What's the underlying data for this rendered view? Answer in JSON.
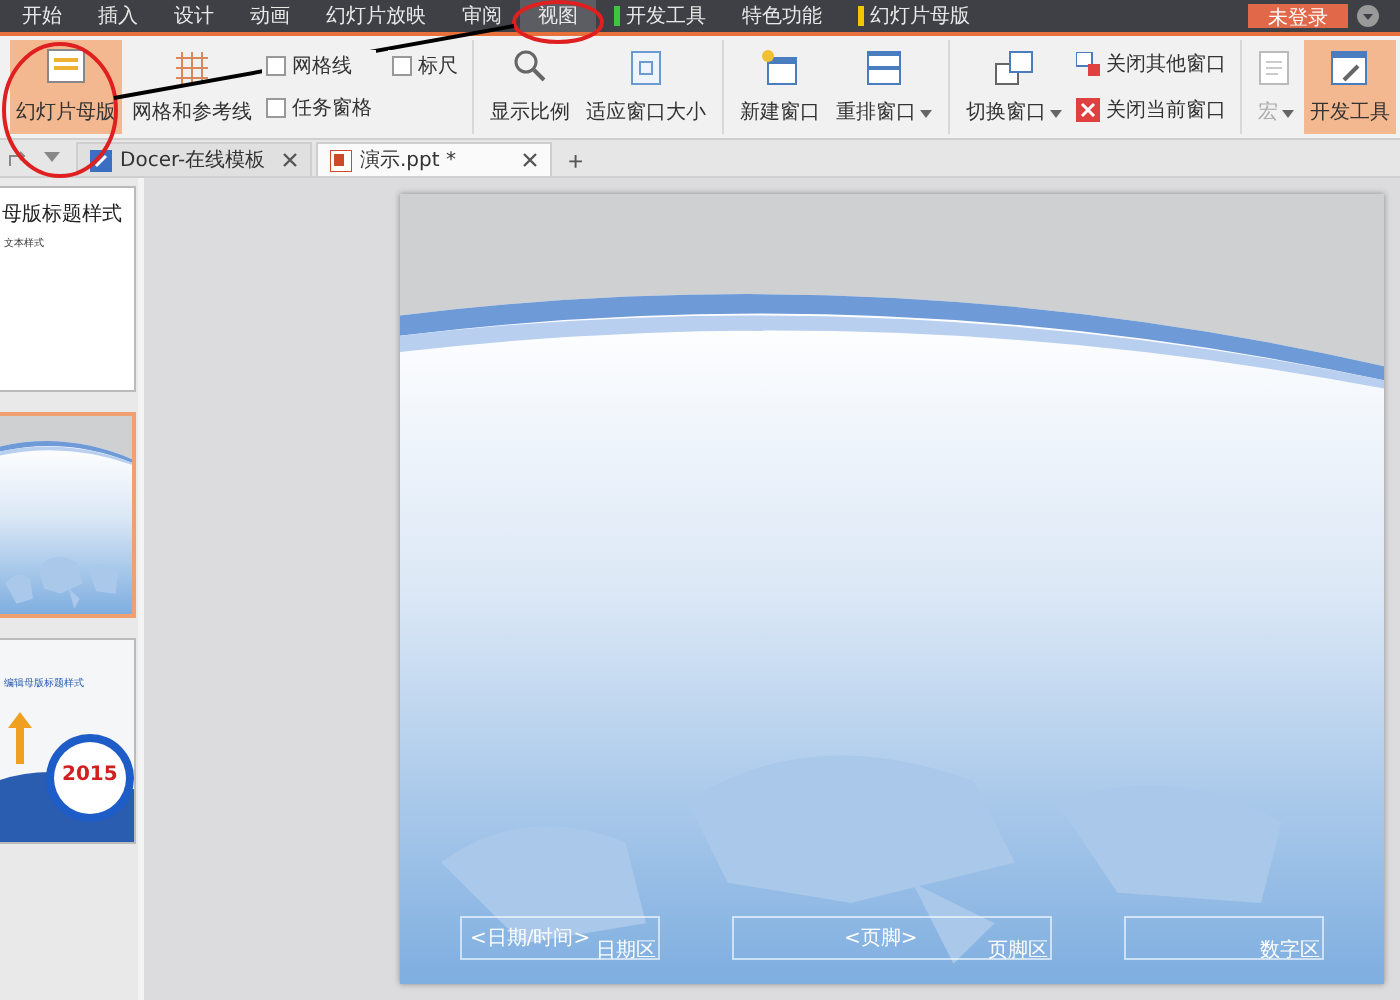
{
  "menu_tabs": [
    {
      "label": "开始",
      "selected": false
    },
    {
      "label": "插入",
      "selected": false
    },
    {
      "label": "设计",
      "selected": false
    },
    {
      "label": "动画",
      "selected": false
    },
    {
      "label": "幻灯片放映",
      "selected": false
    },
    {
      "label": "审阅",
      "selected": false
    },
    {
      "label": "视图",
      "selected": true
    },
    {
      "label": "开发工具",
      "selected": false,
      "color": "#3cc83c"
    },
    {
      "label": "特色功能",
      "selected": false
    },
    {
      "label": "幻灯片母版",
      "selected": false,
      "color": "#f0c800"
    }
  ],
  "login_button": "未登录",
  "ribbon": [
    {
      "items": [
        {
          "kind": "large",
          "label": "幻灯片母版",
          "selected": true
        },
        {
          "kind": "large",
          "label": "网格和参考线",
          "selected": false
        },
        {
          "kind": "checks",
          "checks": [
            {
              "label": "网格线",
              "checked": false
            },
            {
              "label": "标尺",
              "checked": false
            },
            {
              "label": "任务窗格",
              "checked": false
            }
          ]
        }
      ]
    },
    {
      "items": [
        {
          "kind": "large",
          "label": "显示比例",
          "selected": false
        },
        {
          "kind": "large",
          "label": "适应窗口大小",
          "selected": false
        }
      ]
    },
    {
      "items": [
        {
          "kind": "large",
          "label": "新建窗口",
          "selected": false
        },
        {
          "kind": "large",
          "label": "重排窗口",
          "selected": false,
          "dropdown": true
        }
      ]
    },
    {
      "items": [
        {
          "kind": "large",
          "label": "切换窗口",
          "selected": false,
          "dropdown": true
        },
        {
          "kind": "smalls",
          "smalls": [
            {
              "label": "关闭其他窗口"
            },
            {
              "label": "关闭当前窗口"
            }
          ]
        }
      ]
    },
    {
      "items": [
        {
          "kind": "large",
          "label": "宏",
          "selected": false,
          "dropdown": true,
          "disabled": true
        },
        {
          "kind": "large",
          "label": "开发工具",
          "selected": true
        }
      ]
    }
  ],
  "doc_tabs": [
    {
      "label": "Docer-在线模板",
      "selected": false
    },
    {
      "label": "演示.ppt *",
      "selected": true
    }
  ],
  "new_tab_button": "+",
  "thumbnails": [
    {
      "kind": "title",
      "selected": false,
      "title": "母版标题样式",
      "body": "文本样式"
    },
    {
      "kind": "picture",
      "selected": true
    },
    {
      "kind": "badge",
      "selected": false,
      "title": "编辑母版标题样式",
      "badge": "2015"
    }
  ],
  "slide": {
    "footer": [
      {
        "placeholder": "<日期/时间>",
        "area": "日期区"
      },
      {
        "placeholder": "<页脚>",
        "area": "页脚区"
      },
      {
        "area": "数字区"
      }
    ]
  }
}
